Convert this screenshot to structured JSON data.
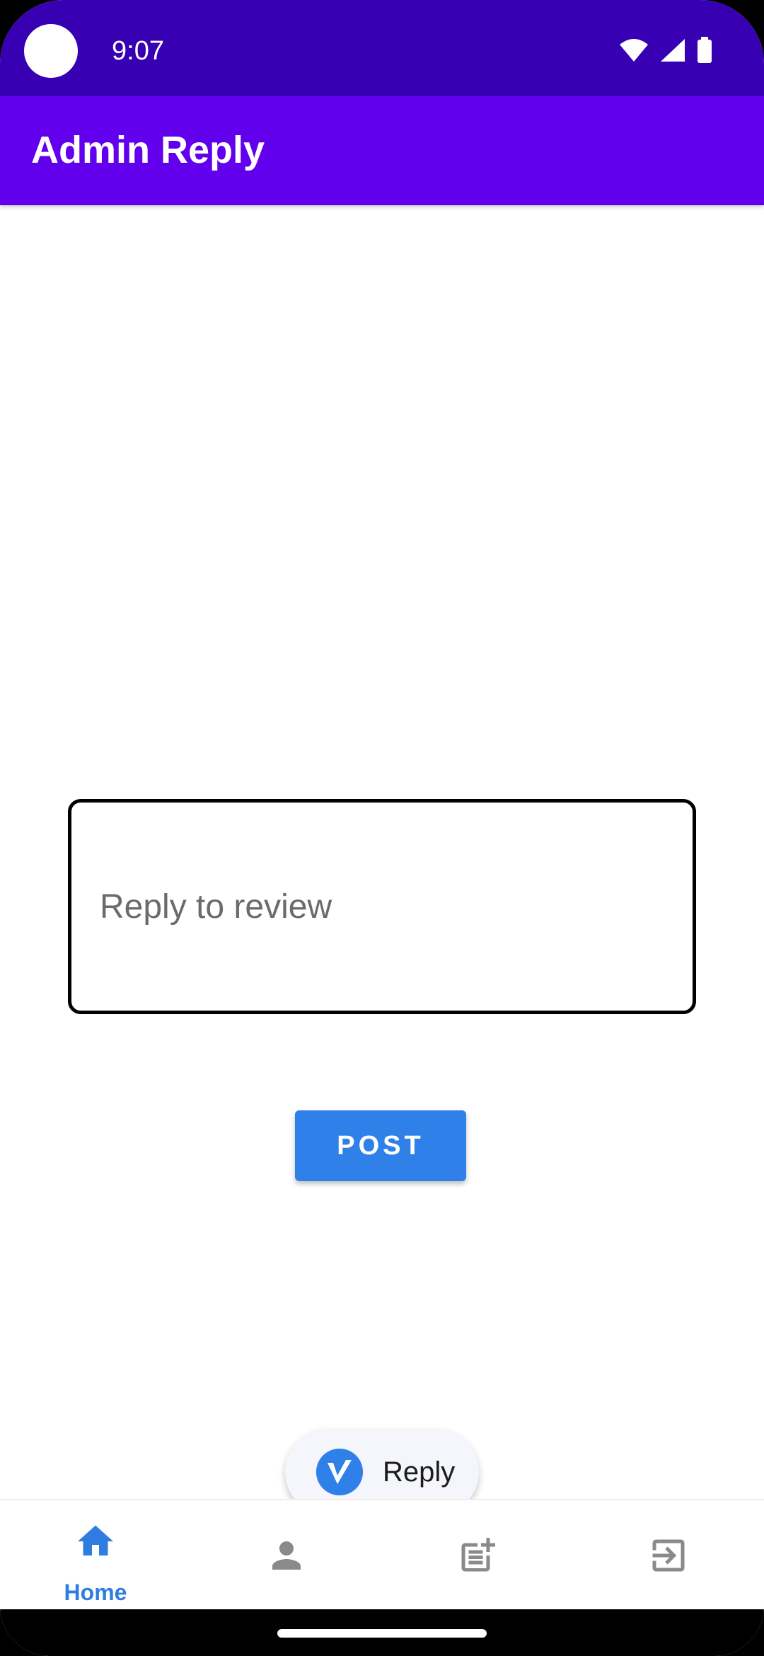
{
  "status_bar": {
    "time": "9:07"
  },
  "app_bar": {
    "title": "Admin Reply"
  },
  "reply": {
    "placeholder": "Reply to review",
    "value": ""
  },
  "post_button": {
    "label": "POST"
  },
  "toast": {
    "text": "Reply"
  },
  "bottom_nav": {
    "items": [
      {
        "label": "Home",
        "icon": "home-icon",
        "selected": true
      },
      {
        "label": "",
        "icon": "person-icon",
        "selected": false
      },
      {
        "label": "",
        "icon": "post-add-icon",
        "selected": false
      },
      {
        "label": "",
        "icon": "logout-icon",
        "selected": false
      }
    ]
  },
  "colors": {
    "status_bar": "#3700b3",
    "app_bar": "#6200ee",
    "accent_blue": "#2f80e8",
    "nav_inactive": "#8a8a8a"
  }
}
